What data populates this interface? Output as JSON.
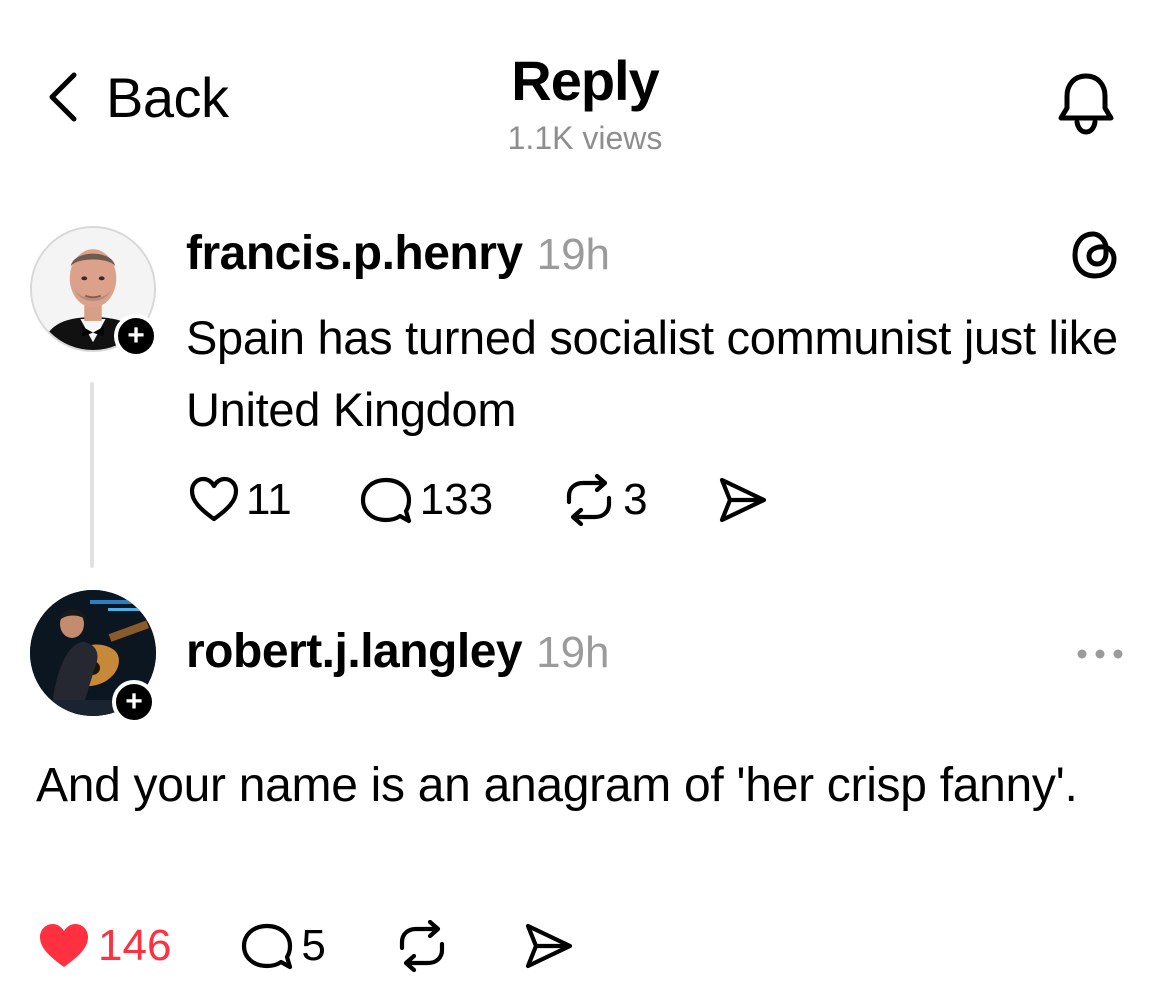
{
  "header": {
    "back_label": "Back",
    "title": "Reply",
    "views": "1.1K views"
  },
  "posts": [
    {
      "username": "francis.p.henry",
      "time": "19h",
      "text": "Spain has turned socialist communist just like United Kingdom",
      "likes": "11",
      "replies": "133",
      "reposts": "3",
      "liked": false,
      "badge": "+"
    },
    {
      "username": "robert.j.langley",
      "time": "19h",
      "text": "And your name is an anagram of 'her crisp fanny'.",
      "likes": "146",
      "replies": "5",
      "liked": true,
      "badge": "+"
    }
  ],
  "icons": {
    "back": "chevron-left-icon",
    "notifications": "bell-icon",
    "app": "threads-logo-icon",
    "like": "heart-icon",
    "reply": "comment-icon",
    "repost": "repost-icon",
    "share": "send-icon",
    "more": "more-horizontal-icon"
  },
  "colors": {
    "liked": "#ff3040",
    "muted": "#9b9b9b",
    "thread_line": "#e2e2e2"
  }
}
